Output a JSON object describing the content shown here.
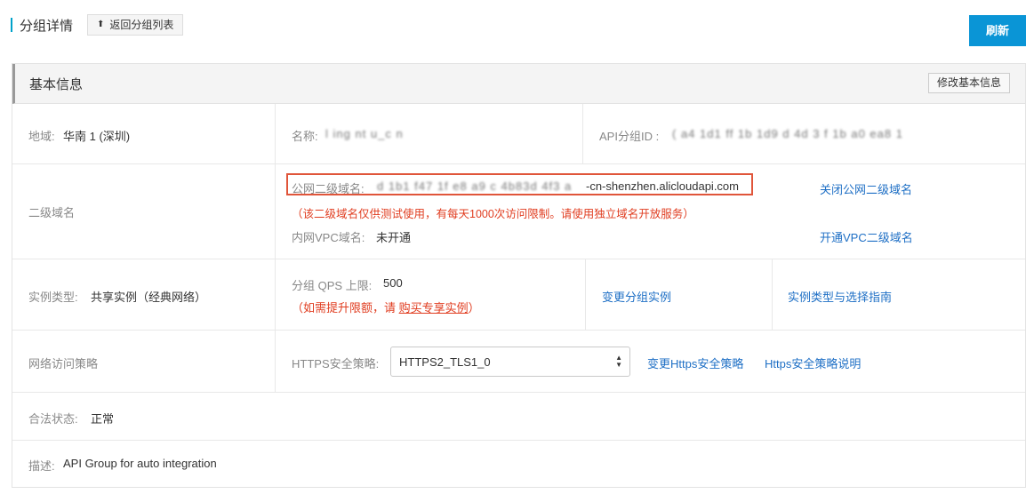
{
  "header": {
    "title": "分组详情",
    "back_label": "返回分组列表",
    "refresh_label": "刷新"
  },
  "panel": {
    "title": "基本信息",
    "edit_label": "修改基本信息"
  },
  "basic": {
    "region_label": "地域:",
    "region_value": "华南 1 (深圳)",
    "name_label": "名称:",
    "name_value": "l ing nt u_c n",
    "group_id_label": "API分组ID :",
    "group_id_value": "( a4 1d1 ff 1b 1d9 d 4d 3 f 1b a0 ea8 1"
  },
  "domain": {
    "row_label": "二级域名",
    "public_label": "公网二级域名:",
    "public_value_blur": "d 1b1 f47 1f e8 a9 c 4b83d 4f3 a",
    "public_value_suffix": "-cn-shenzhen.alicloudapi.com",
    "public_notice": "（该二级域名仅供测试使用，有每天1000次访问限制。请使用独立域名开放服务）",
    "close_public_link": "关闭公网二级域名",
    "vpc_label": "内网VPC域名:",
    "vpc_value": "未开通",
    "open_vpc_link": "开通VPC二级域名"
  },
  "instance": {
    "type_label": "实例类型:",
    "type_value": "共享实例（经典网络）",
    "qps_label": "分组 QPS 上限:",
    "qps_value": "500",
    "qps_notice_prefix": "（如需提升限额，请 ",
    "qps_notice_link": "购买专享实例",
    "qps_notice_suffix": "）",
    "change_link": "变更分组实例",
    "guide_link": "实例类型与选择指南"
  },
  "network": {
    "row_label": "网络访问策略",
    "https_label": "HTTPS安全策略:",
    "https_selected": "HTTPS2_TLS1_0",
    "change_https_link": "变更Https安全策略",
    "https_doc_link": "Https安全策略说明"
  },
  "legal": {
    "label": "合法状态:",
    "value": "正常"
  },
  "desc": {
    "label": "描述:",
    "value": "API Group for auto integration"
  },
  "colors": {
    "accent": "#0a95d6",
    "link": "#1e6fc5",
    "warning": "#e03c1f",
    "highlight_border": "#e0553a"
  },
  "icons": {
    "back": "upload-arrow-icon",
    "select": "select-caret-icon"
  }
}
